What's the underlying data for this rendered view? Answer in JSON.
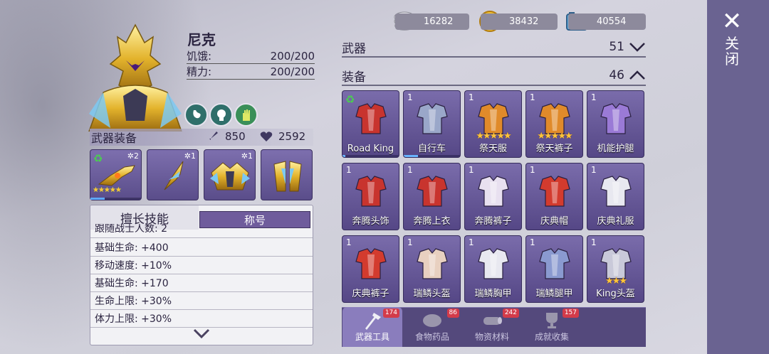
{
  "character": {
    "name": "尼克",
    "stats": [
      {
        "label": "饥饿:",
        "value": "200/200"
      },
      {
        "label": "精力:",
        "value": "200/200"
      }
    ],
    "buffs": [
      "stomach-icon",
      "brain-icon",
      "hand-icon"
    ]
  },
  "weapon_equip": {
    "title": "武器装备",
    "attack": "850",
    "health": "2592",
    "slots": [
      {
        "icon": "golden-gun-icon",
        "level": "2",
        "stars": "★★★★★"
      },
      {
        "icon": "golden-blade-icon",
        "level": "1",
        "stars": ""
      },
      {
        "icon": "golden-armor-icon",
        "level": "1",
        "stars": ""
      },
      {
        "icon": "golden-legs-icon",
        "level": "",
        "stars": ""
      }
    ]
  },
  "skills": {
    "tab_skill": "擅长技能",
    "tab_title": "称号",
    "lines": [
      "跟随战士人数: 2",
      "基础生命: +400",
      "移动速度: +10%",
      "基础生命: +170",
      "生命上限: +30%",
      "体力上限: +30%"
    ]
  },
  "currency": [
    {
      "icon": "silver-coin-icon",
      "value": "16282",
      "color": "#c5c5cc"
    },
    {
      "icon": "gold-coin-icon",
      "value": "38432",
      "color": "#f3c130"
    },
    {
      "icon": "photo-ticket-icon",
      "value": "40554",
      "color": "#69b7e8"
    }
  ],
  "categories": [
    {
      "label": "武器",
      "count": "51",
      "expanded": false
    },
    {
      "label": "装备",
      "count": "46",
      "expanded": true
    }
  ],
  "items": [
    {
      "name": "Road King",
      "qty": "",
      "stars": "",
      "refresh": true,
      "progress_fraction": 0.05,
      "icon": "motorcycle-icon"
    },
    {
      "name": "自行车",
      "qty": "1",
      "stars": "",
      "refresh": false,
      "progress_fraction": 0.25,
      "icon": "bicycle-icon"
    },
    {
      "name": "祭天服",
      "qty": "1",
      "stars": "★★★★★",
      "refresh": false,
      "icon": "ritual-robe-icon"
    },
    {
      "name": "祭天裤子",
      "qty": "1",
      "stars": "★★★★★",
      "refresh": false,
      "icon": "ritual-pants-icon"
    },
    {
      "name": "机能护腿",
      "qty": "1",
      "stars": "",
      "refresh": false,
      "icon": "mech-legguards-icon"
    },
    {
      "name": "奔腾头饰",
      "qty": "1",
      "stars": "",
      "refresh": false,
      "icon": "horse-headgear-icon"
    },
    {
      "name": "奔腾上衣",
      "qty": "1",
      "stars": "",
      "refresh": false,
      "icon": "horse-top-icon"
    },
    {
      "name": "奔腾裤子",
      "qty": "1",
      "stars": "",
      "refresh": false,
      "icon": "horse-pants-icon"
    },
    {
      "name": "庆典帽",
      "qty": "1",
      "stars": "",
      "refresh": false,
      "icon": "party-hat-icon"
    },
    {
      "name": "庆典礼服",
      "qty": "1",
      "stars": "",
      "refresh": false,
      "icon": "party-dress-icon"
    },
    {
      "name": "庆典裤子",
      "qty": "1",
      "stars": "",
      "refresh": false,
      "icon": "party-pants-icon"
    },
    {
      "name": "瑞鳞头盔",
      "qty": "1",
      "stars": "",
      "refresh": false,
      "icon": "dragon-helmet-icon"
    },
    {
      "name": "瑞鳞胸甲",
      "qty": "1",
      "stars": "",
      "refresh": false,
      "icon": "dragon-chest-icon"
    },
    {
      "name": "瑞鳞腿甲",
      "qty": "1",
      "stars": "",
      "refresh": false,
      "icon": "dragon-legs-icon"
    },
    {
      "name": "King头盔",
      "qty": "1",
      "stars": "★★★",
      "refresh": false,
      "icon": "king-helmet-icon"
    }
  ],
  "bottom_tabs": [
    {
      "label": "武器工具",
      "badge": "174",
      "active": true,
      "icon": "axe-hammer-icon"
    },
    {
      "label": "食物药品",
      "badge": "86",
      "active": false,
      "icon": "meat-icon"
    },
    {
      "label": "物资材料",
      "badge": "242",
      "active": false,
      "icon": "log-icon"
    },
    {
      "label": "成就收集",
      "badge": "157",
      "active": false,
      "icon": "trophy-icon"
    }
  ],
  "close": {
    "label": "关闭",
    "icon": "close-icon"
  }
}
